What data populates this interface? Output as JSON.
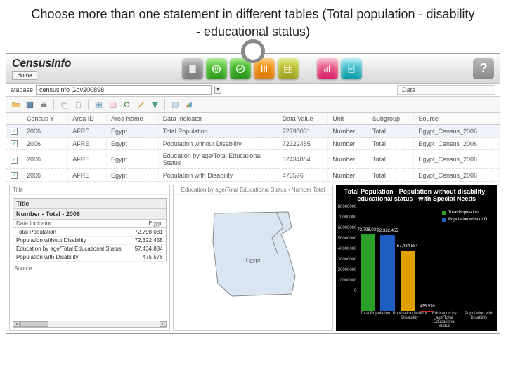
{
  "slide": {
    "title": "Choose more than one statement in different  tables (Total population - disability - educational status)"
  },
  "app": {
    "logo": "CensusInfo",
    "home_label": "Home",
    "database_label": "atabase",
    "database_value": "censusinfo Gov200898",
    "data_panel_label": "Data",
    "help_label": "?",
    "cubes": [
      "doc-icon",
      "globe-icon",
      "check-icon",
      "sliders-icon",
      "grid-icon",
      "chart-icon",
      "page-icon"
    ]
  },
  "columns": [
    "",
    "Census Y",
    "Area ID",
    "Area Name",
    "Data Indicator",
    "Data Value",
    "Unit",
    "Subgroup",
    "Source"
  ],
  "rows": [
    {
      "checked": true,
      "year": "2006",
      "area_id": "AFRE",
      "area_name": "Egypt",
      "indicator": "Total Population",
      "value": "72798031",
      "unit": "Number",
      "subgroup": "Total",
      "source": "Egypt_Census_2006"
    },
    {
      "checked": true,
      "year": "2006",
      "area_id": "AFRE",
      "area_name": "Egypt",
      "indicator": "Population without Disability",
      "value": "72322455",
      "unit": "Number",
      "subgroup": "Total",
      "source": "Egypt_Census_2006"
    },
    {
      "checked": true,
      "year": "2006",
      "area_id": "AFRE",
      "area_name": "Egypt",
      "indicator": "Education by age/Total Educational Status",
      "value": "57434884",
      "unit": "Number",
      "subgroup": "Total",
      "source": "Egypt_Census_2006"
    },
    {
      "checked": true,
      "year": "2006",
      "area_id": "AFRE",
      "area_name": "Egypt",
      "indicator": "Population with Disability",
      "value": "475576",
      "unit": "Number",
      "subgroup": "Total",
      "source": "Egypt_Census_2006"
    }
  ],
  "panel_table": {
    "tab_label": "Title",
    "title": "Title",
    "subtitle": "Number - Total  - 2006",
    "header_left": "Data Indicator",
    "header_right": "Egypt",
    "rows": [
      {
        "label": "Total Population",
        "value": "72,798,031"
      },
      {
        "label": "Population without Disability",
        "value": "72,322,455"
      },
      {
        "label": "Education by age/Total Educational Status",
        "value": "57,434,884"
      },
      {
        "label": "Population with Disability",
        "value": "475,576"
      }
    ],
    "source_label": "Source"
  },
  "panel_map": {
    "caption": "Education by age/Total Educational Status - Number Total",
    "country_label": "Egypt"
  },
  "chart_data": {
    "type": "bar",
    "title": "Total Population - Population without disability - educational status - with Special Needs",
    "categories": [
      "Total Population",
      "Population without Disability",
      "Education by age/Total Educational Status",
      "Population with Disability"
    ],
    "values": [
      72798031,
      72322455,
      57434884,
      475576
    ],
    "value_labels": [
      "72,798,031",
      "72,322,455",
      "57,434,884",
      "475,576"
    ],
    "yticks": [
      "80000000",
      "70000000",
      "60000000",
      "50000000",
      "40000000",
      "30000000",
      "20000000",
      "10000000",
      "0"
    ],
    "ylim": [
      0,
      80000000
    ],
    "colors": [
      "#2aa02a",
      "#1f5fc4",
      "#e0a000",
      "#c62828"
    ],
    "legend": [
      {
        "label": "Total Population",
        "color": "#2aa02a"
      },
      {
        "label": "Population without D",
        "color": "#1f5fc4"
      }
    ]
  }
}
